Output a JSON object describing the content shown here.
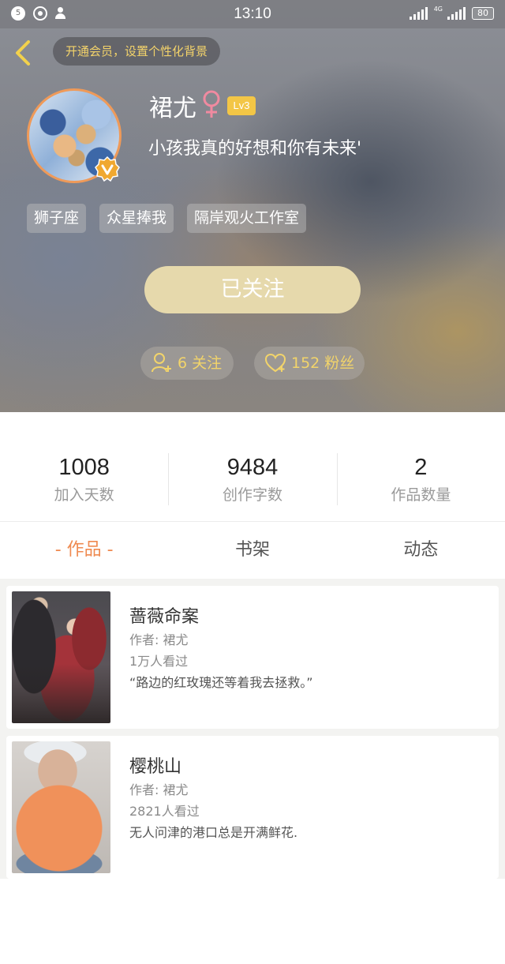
{
  "status_bar": {
    "time": "13:10",
    "notification_count": "5",
    "network_tag": "4G",
    "battery": "80"
  },
  "header": {
    "vip_banner": "开通会员，设置个性化背景",
    "username": "裙尤",
    "gender_symbol": "♀",
    "level": "Lv3",
    "signature": "小孩我真的好想和你有未来'",
    "tags": [
      "狮子座",
      "众星捧我",
      "隔岸观火工作室"
    ],
    "follow_button": "已关注",
    "following_label": "6 关注",
    "fans_label": "152 粉丝"
  },
  "stats": [
    {
      "value": "1008",
      "label": "加入天数"
    },
    {
      "value": "9484",
      "label": "创作字数"
    },
    {
      "value": "2",
      "label": "作品数量"
    }
  ],
  "tabs": [
    {
      "label": "- 作品 -",
      "active": true
    },
    {
      "label": "书架",
      "active": false
    },
    {
      "label": "动态",
      "active": false
    }
  ],
  "works": [
    {
      "title": "蔷薇命案",
      "author": "作者: 裙尤",
      "views": "1万人看过",
      "description": "“路边的红玫瑰还等着我去拯救。”"
    },
    {
      "title": "樱桃山",
      "author": "作者: 裙尤",
      "views": "2821人看过",
      "description": "无人问津的港口总是开满鲜花."
    }
  ],
  "colors": {
    "accent_orange": "#ef8a50",
    "gold_text": "#f2d46a",
    "level_badge": "#f3c646",
    "follow_button": "#e6d9ac"
  }
}
